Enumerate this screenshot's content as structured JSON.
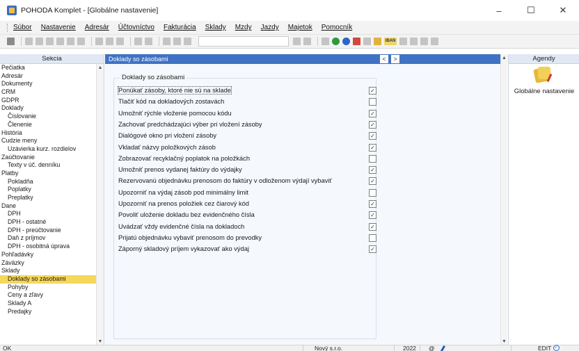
{
  "window": {
    "title": "POHODA Komplet - [Globálne nastavenie]",
    "controls": [
      "–",
      "☐",
      "✕"
    ]
  },
  "menu": [
    "Súbor",
    "Nastavenie",
    "Adresár",
    "Účtovníctvo",
    "Fakturácia",
    "Sklady",
    "Mzdy",
    "Jazdy",
    "Majetok",
    "Pomocník"
  ],
  "sidebar": {
    "header": "Sekcia",
    "items": [
      {
        "label": "Pečiatka",
        "level": 0
      },
      {
        "label": "Adresár",
        "level": 0
      },
      {
        "label": "Dokumenty",
        "level": 0
      },
      {
        "label": "CRM",
        "level": 0
      },
      {
        "label": "GDPR",
        "level": 0
      },
      {
        "label": "Doklady",
        "level": 0
      },
      {
        "label": "Číslovanie",
        "level": 1
      },
      {
        "label": "Členenie",
        "level": 1
      },
      {
        "label": "História",
        "level": 0
      },
      {
        "label": "Cudzie meny",
        "level": 0
      },
      {
        "label": "Uzávierka kurz. rozdielov",
        "level": 1
      },
      {
        "label": "Zaúčtovanie",
        "level": 0
      },
      {
        "label": "Texty v úč. denníku",
        "level": 1
      },
      {
        "label": "Platby",
        "level": 0
      },
      {
        "label": "Pokladňa",
        "level": 1
      },
      {
        "label": "Poplatky",
        "level": 1
      },
      {
        "label": "Preplatky",
        "level": 1
      },
      {
        "label": "Dane",
        "level": 0
      },
      {
        "label": "DPH",
        "level": 1
      },
      {
        "label": "DPH - ostatné",
        "level": 1
      },
      {
        "label": "DPH - preúčtovanie",
        "level": 1
      },
      {
        "label": "Daň z príjmov",
        "level": 1
      },
      {
        "label": "DPH - osobitná úprava",
        "level": 1
      },
      {
        "label": "Pohľadávky",
        "level": 0
      },
      {
        "label": "Záväzky",
        "level": 0
      },
      {
        "label": "Sklady",
        "level": 0
      },
      {
        "label": "Doklady so zásobami",
        "level": 1,
        "selected": true
      },
      {
        "label": "Pohyby",
        "level": 1
      },
      {
        "label": "Ceny a zľavy",
        "level": 1
      },
      {
        "label": "Sklady A",
        "level": 1
      },
      {
        "label": "Predajky",
        "level": 1
      }
    ]
  },
  "main": {
    "header": "Doklady so zásobami",
    "prev": "<",
    "next": ">",
    "group_title": "Doklady so zásobami",
    "options": [
      {
        "label": "Ponúkať zásoby, ktoré nie sú na sklade",
        "checked": true
      },
      {
        "label": "Tlačiť kód na dokladových zostavách",
        "checked": false
      },
      {
        "label": "Umožniť rýchle vloženie pomocou kódu",
        "checked": true
      },
      {
        "label": "Zachovať predchádzajúci výber pri vložení zásoby",
        "checked": true
      },
      {
        "label": "Dialógové okno pri vložení zásoby",
        "checked": true
      },
      {
        "label": "Vkladať názvy položkových zásob",
        "checked": true
      },
      {
        "label": "Zobrazovať recyklačný poplatok na položkách",
        "checked": false
      },
      {
        "label": "Umožniť prenos vydanej faktúry do výdajky",
        "checked": true
      },
      {
        "label": "Rezervovanú objednávku prenosom do faktúry v odloženom výdají vybaviť",
        "checked": true
      },
      {
        "label": "Upozorniť na výdaj zásob pod minimálny limit",
        "checked": false
      },
      {
        "label": "Upozorniť na prenos položiek cez čiarový kód",
        "checked": true
      },
      {
        "label": "Povoliť uloženie dokladu bez evidenčného čísla",
        "checked": true
      },
      {
        "label": "Uvádzať vždy evidenčné čísla na dokladoch",
        "checked": true
      },
      {
        "label": "Prijatú objednávku vybaviť prenosom do prevodky",
        "checked": false
      },
      {
        "label": "Záporný skladový príjem vykazovať ako výdaj",
        "checked": true
      }
    ]
  },
  "agendy": {
    "header": "Agendy",
    "items": [
      {
        "label": "Globálne nastavenie",
        "icon": "settings-agenda-icon"
      }
    ]
  },
  "status": {
    "left": "OK",
    "company": "Nový s.r.o.",
    "year": "2022",
    "at": "@",
    "mode": "EDIT"
  },
  "colors": {
    "header_blue": "#3f72c4",
    "selected_yellow": "#f5d75a",
    "panel_header": "#e1e8f3"
  }
}
